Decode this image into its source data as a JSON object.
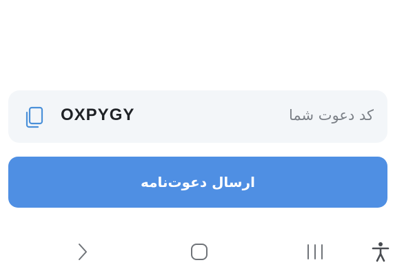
{
  "invite": {
    "label": "کد دعوت شما",
    "code": "OXPYGY",
    "copy_icon": "copy-icon"
  },
  "send_button": {
    "label": "ارسال دعوت‌نامه",
    "color": "#4f8fe3"
  },
  "nav_bar": {
    "items": [
      {
        "name": "back",
        "icon": "chevron-right-icon"
      },
      {
        "name": "home",
        "icon": "rounded-square-icon"
      },
      {
        "name": "recents",
        "icon": "three-bars-icon"
      },
      {
        "name": "accessibility",
        "icon": "accessibility-person-icon"
      }
    ]
  }
}
